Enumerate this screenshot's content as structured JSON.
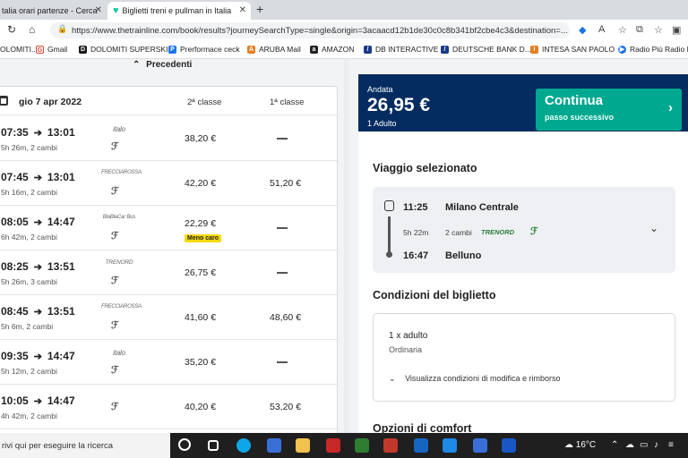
{
  "browser": {
    "tabs": [
      {
        "title": "talia orari partenze - Cerca"
      },
      {
        "title": "Biglietti treni e pullman in Italia"
      }
    ],
    "url": "https://www.thetrainline.com/book/results?journeySearchType=single&origin=3acaacd12b1de30c0c8b341bf2cbe4c3&destination=...",
    "bookmarks": [
      {
        "label": "OLOMITI...",
        "color": "#c0392b"
      },
      {
        "label": "Gmail",
        "color": "#db4437"
      },
      {
        "label": "DOLOMITI SUPERSKI",
        "color": "#1a1a1a"
      },
      {
        "label": "Prerformace ceck",
        "color": "#1a73e8"
      },
      {
        "label": "ARUBA Mail",
        "color": "#e67e22"
      },
      {
        "label": "AMAZON",
        "color": "#222222"
      },
      {
        "label": "DB INTERACTIVE",
        "color": "#1a3a8a"
      },
      {
        "label": "DEUTSCHE BANK D...",
        "color": "#1a3a8a"
      },
      {
        "label": "INTESA SAN PAOLO",
        "color": "#e67e22"
      },
      {
        "label": "Radio Più",
        "color": "#1a73e8"
      },
      {
        "label": "Radio Più",
        "color": "#1a73e8"
      }
    ]
  },
  "results": {
    "prev_label": "Precedenti",
    "date": "gio 7 apr 2022",
    "col2": "2ª classe",
    "col1": "1ª classe",
    "rows": [
      {
        "dep": "07:35",
        "arr": "13:01",
        "info": "5h 26m, 2 cambi",
        "op": "italo",
        "p2": "38,20 €",
        "p1": null,
        "badge": null
      },
      {
        "dep": "07:45",
        "arr": "13:01",
        "info": "5h 16m, 2 cambi",
        "op": "FRECCIAROSSA",
        "p2": "42,20 €",
        "p1": "51,20 €",
        "badge": null
      },
      {
        "dep": "08:05",
        "arr": "14:47",
        "info": "6h 42m, 2 cambi",
        "op": "BlaBlaCar Bus",
        "p2": "22,29 €",
        "p1": null,
        "badge": "Meno caro"
      },
      {
        "dep": "08:25",
        "arr": "13:51",
        "info": "5h 26m, 3 cambi",
        "op": "TRENORD",
        "p2": "26,75 €",
        "p1": null,
        "badge": null
      },
      {
        "dep": "08:45",
        "arr": "13:51",
        "info": "5h 6m, 2 cambi",
        "op": "FRECCIAROSSA",
        "p2": "41,60 €",
        "p1": "48,60 €",
        "badge": null
      },
      {
        "dep": "09:35",
        "arr": "14:47",
        "info": "5h 12m, 2 cambi",
        "op": "italo",
        "p2": "35,20 €",
        "p1": null,
        "badge": null
      },
      {
        "dep": "10:05",
        "arr": "14:47",
        "info": "4h 42m, 2 cambi",
        "op": "",
        "p2": "40,20 €",
        "p1": "53,20 €",
        "badge": null
      }
    ]
  },
  "summary": {
    "label": "Andata",
    "price": "26,95 €",
    "pax": "1 Adulto",
    "continue_title": "Continua",
    "continue_sub": "passo successivo"
  },
  "selected": {
    "title": "Viaggio selezionato",
    "dep_time": "11:25",
    "from": "Milano Centrale",
    "duration": "5h 22m",
    "changes": "2 cambi",
    "operator": "TRENORD",
    "arr_time": "16:47",
    "to": "Belluno"
  },
  "conditions": {
    "title": "Condizioni del biglietto",
    "pax": "1 x adulto",
    "fare": "Ordinaria",
    "link": "Visualizza condizioni di modifica e rimborso"
  },
  "comfort": {
    "title": "Opzioni di comfort"
  },
  "taskbar": {
    "search": "rivi qui per eseguire la ricerca",
    "temp": "16°C"
  }
}
